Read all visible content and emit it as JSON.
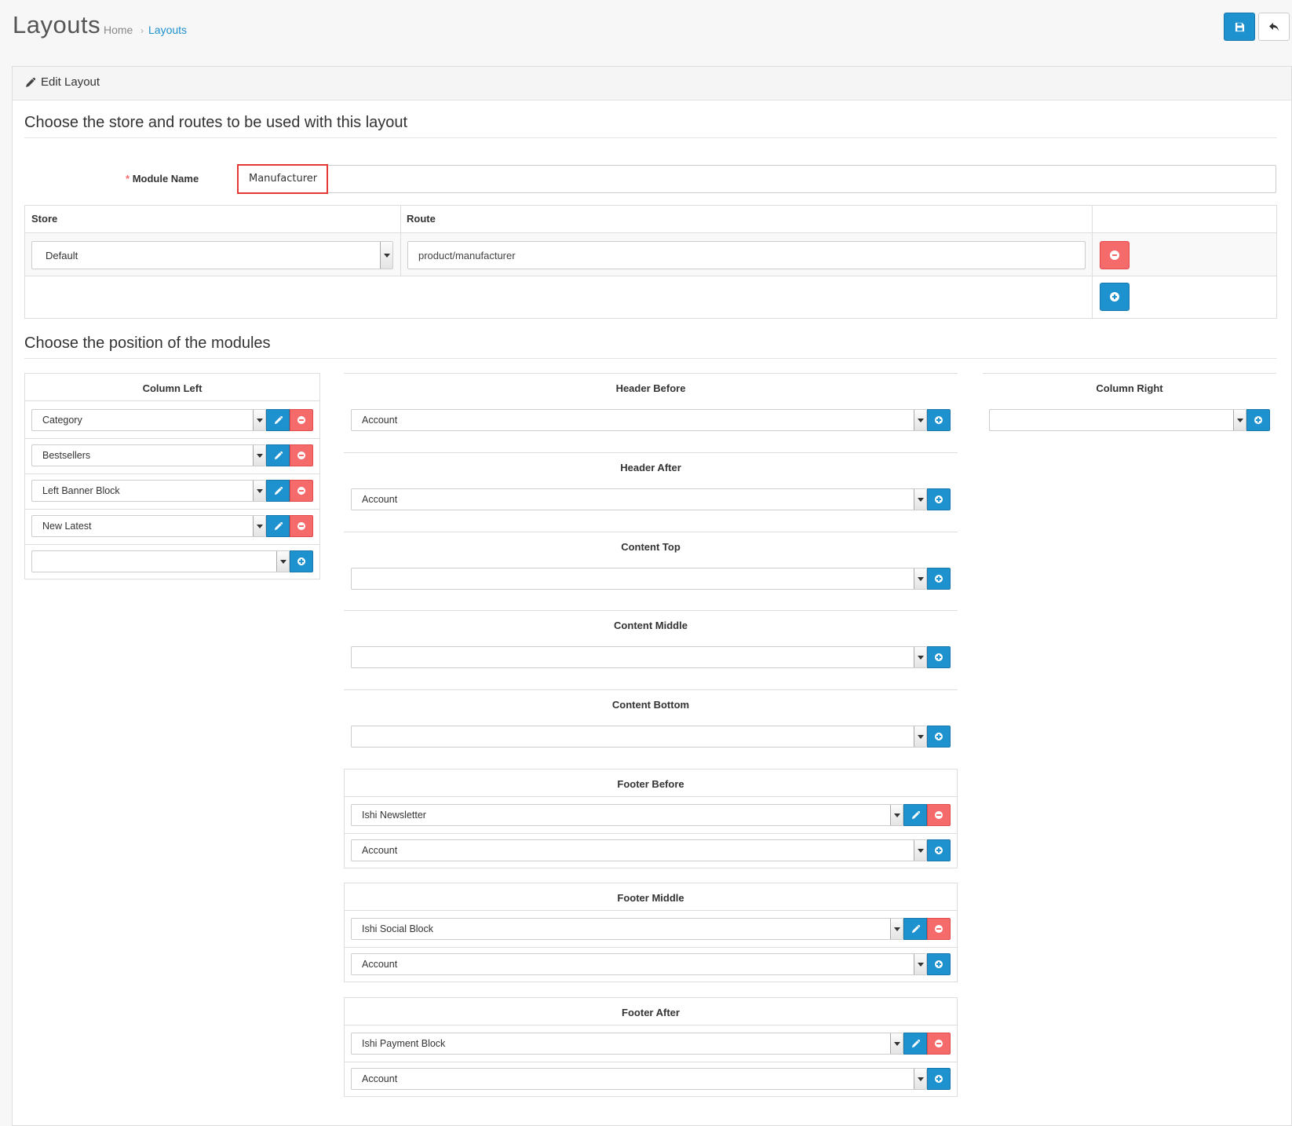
{
  "header": {
    "title": "Layouts",
    "breadcrumb": {
      "home": "Home",
      "separator": "›",
      "current": "Layouts"
    }
  },
  "panel": {
    "title": "Edit Layout",
    "section1_legend": "Choose the store and routes to be used with this layout",
    "module_name_label": "Module Name",
    "module_name_required": "*",
    "module_name_value": "Manufacturer",
    "table": {
      "store_header": "Store",
      "route_header": "Route",
      "rows": [
        {
          "store": "Default",
          "route": "product/manufacturer"
        }
      ]
    },
    "section2_legend": "Choose the position of the modules"
  },
  "positions": {
    "column_left": {
      "title": "Column Left",
      "modules": [
        "Category",
        "Bestsellers",
        "Left Banner Block",
        "New Latest"
      ],
      "add_value": ""
    },
    "header_before": {
      "title": "Header Before",
      "add_value": "Account"
    },
    "header_after": {
      "title": "Header After",
      "add_value": "Account"
    },
    "content_top": {
      "title": "Content Top",
      "add_value": ""
    },
    "content_middle": {
      "title": "Content Middle",
      "add_value": ""
    },
    "content_bottom": {
      "title": "Content Bottom",
      "add_value": ""
    },
    "footer_before": {
      "title": "Footer Before",
      "modules": [
        "Ishi Newsletter"
      ],
      "add_value": "Account"
    },
    "footer_middle": {
      "title": "Footer Middle",
      "modules": [
        "Ishi Social Block"
      ],
      "add_value": "Account"
    },
    "footer_after": {
      "title": "Footer After",
      "modules": [
        "Ishi Payment Block"
      ],
      "add_value": "Account"
    },
    "column_right": {
      "title": "Column Right",
      "add_value": ""
    }
  },
  "colors": {
    "primary": "#1e91cf",
    "danger": "#f56b6b",
    "highlight": "#e53935"
  },
  "icons": {
    "save": "save-icon",
    "back": "reply-icon",
    "edit": "pencil-icon",
    "add": "plus-circle-icon",
    "remove": "minus-circle-icon"
  }
}
